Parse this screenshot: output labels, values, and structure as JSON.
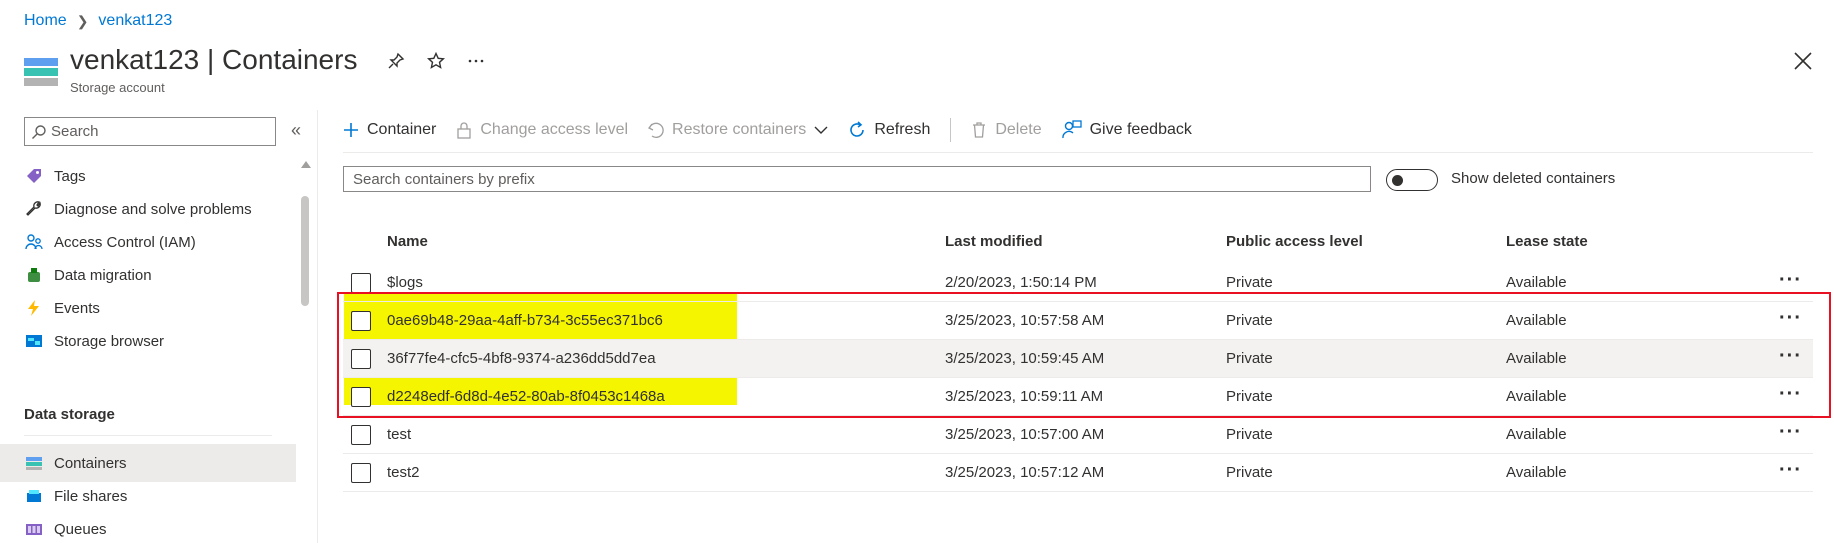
{
  "breadcrumb": {
    "home": "Home",
    "current": "venkat123"
  },
  "header": {
    "title": "venkat123 | Containers",
    "subtitle": "Storage account"
  },
  "nav": {
    "search_placeholder": "Search",
    "collapse_glyph": "«",
    "items": [
      {
        "label": "Tags",
        "icon": "tag-icon"
      },
      {
        "label": "Diagnose and solve problems",
        "icon": "wrench-icon"
      },
      {
        "label": "Access Control (IAM)",
        "icon": "people-icon"
      },
      {
        "label": "Data migration",
        "icon": "migration-icon"
      },
      {
        "label": "Events",
        "icon": "lightning-icon"
      },
      {
        "label": "Storage browser",
        "icon": "storage-browser-icon"
      }
    ],
    "section_title": "Data storage",
    "section_items": [
      {
        "label": "Containers",
        "icon": "containers-icon",
        "active": true
      },
      {
        "label": "File shares",
        "icon": "file-shares-icon"
      },
      {
        "label": "Queues",
        "icon": "queues-icon"
      }
    ]
  },
  "toolbar": {
    "container": "Container",
    "change_access": "Change access level",
    "restore": "Restore containers",
    "refresh": "Refresh",
    "delete": "Delete",
    "feedback": "Give feedback"
  },
  "search": {
    "placeholder": "Search containers by prefix",
    "toggle_label": "Show deleted containers"
  },
  "table": {
    "headers": {
      "name": "Name",
      "modified": "Last modified",
      "access": "Public access level",
      "lease": "Lease state"
    },
    "rows": [
      {
        "name": "$logs",
        "modified": "2/20/2023, 1:50:14 PM",
        "access": "Private",
        "lease": "Available",
        "selected": false
      },
      {
        "name": "0ae69b48-29aa-4aff-b734-3c55ec371bc6",
        "modified": "3/25/2023, 10:57:58 AM",
        "access": "Private",
        "lease": "Available",
        "selected": false
      },
      {
        "name": "36f77fe4-cfc5-4bf8-9374-a236dd5dd7ea",
        "modified": "3/25/2023, 10:59:45 AM",
        "access": "Private",
        "lease": "Available",
        "selected": true
      },
      {
        "name": "d2248edf-6d8d-4e52-80ab-8f0453c1468a",
        "modified": "3/25/2023, 10:59:11 AM",
        "access": "Private",
        "lease": "Available",
        "selected": false
      },
      {
        "name": "test",
        "modified": "3/25/2023, 10:57:00 AM",
        "access": "Private",
        "lease": "Available",
        "selected": false
      },
      {
        "name": "test2",
        "modified": "3/25/2023, 10:57:12 AM",
        "access": "Private",
        "lease": "Available",
        "selected": false
      }
    ],
    "more_glyph": "···"
  },
  "colors": {
    "accent": "#0078d4",
    "highlight": "#f5f500",
    "annotation": "#e81123"
  }
}
